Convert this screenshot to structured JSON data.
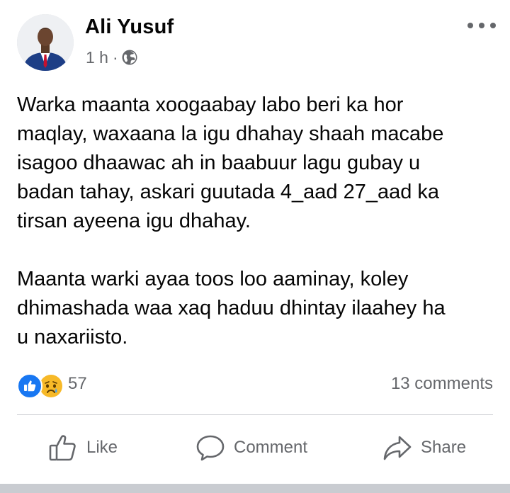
{
  "post": {
    "author": "Ali Yusuf",
    "timestamp": "1 h",
    "separator": "·",
    "privacy_icon": "globe-icon",
    "paragraphs": [
      "Warka maanta xoogaabay labo beri ka hor\nmaqlay,  waxaana la igu dhahay shaah macabe\nisagoo dhaawac ah in baabuur lagu gubay u\nbadan tahay, askari guutada 4_aad 27_aad ka\ntirsan ayeena igu dhahay.",
      "Maanta warki ayaa toos loo aaminay, koley\ndhimashada waa xaq haduu dhintay ilaahey ha\nu naxariisto."
    ]
  },
  "reactions": {
    "types": [
      "like",
      "sad"
    ],
    "count": "57",
    "comments": "13 comments"
  },
  "actions": {
    "like": "Like",
    "comment": "Comment",
    "share": "Share"
  },
  "colors": {
    "text": "#050505",
    "secondary": "#65676b",
    "like_blue": "#1877f2",
    "sad_yellow": "#f7b928",
    "divider": "#ced0d4"
  }
}
